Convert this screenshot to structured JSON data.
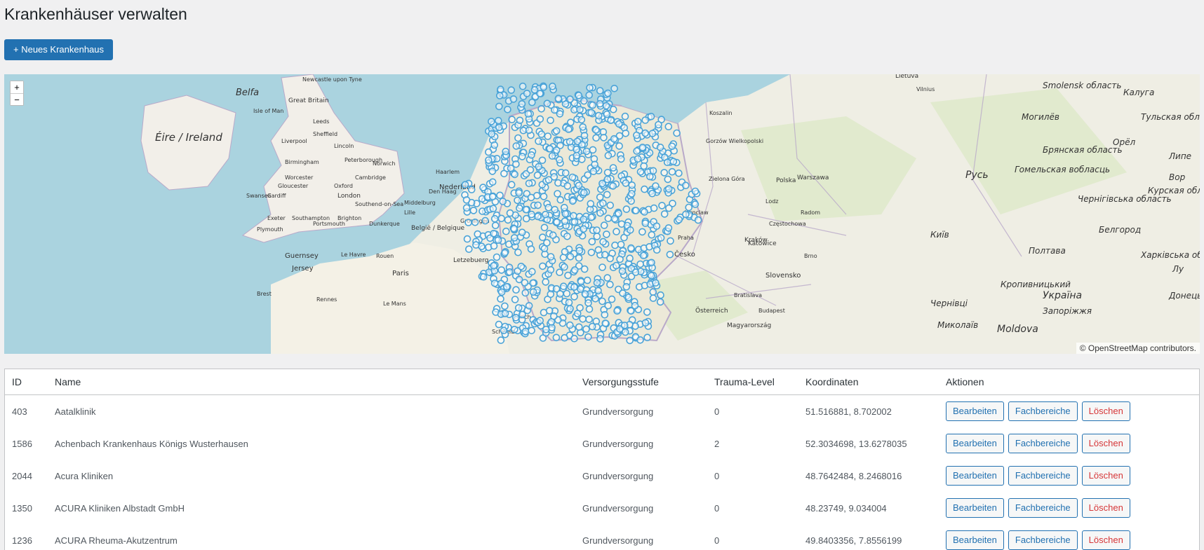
{
  "page": {
    "title": "Krankenhäuser verwalten"
  },
  "actions": {
    "add_label": "+ Neues Krankenhaus"
  },
  "map": {
    "zoom_in": "+",
    "zoom_out": "−",
    "attribution": "© OpenStreetMap contributors.",
    "marker_color": "#4aa3d8",
    "labels": [
      "Belfa",
      "Newcastle upon Tyne",
      "Great Britain",
      "Isle of Man",
      "Éire / Ireland",
      "Leeds",
      "Sheffield",
      "Liverpool",
      "Lincoln",
      "Birmingham",
      "Peterborough",
      "Norwich",
      "Worcester",
      "Cambridge",
      "Gloucester",
      "Oxford",
      "Swansea",
      "Cardiff",
      "London",
      "Southend-on-Sea",
      "Exeter",
      "Southampton",
      "Brighton",
      "Portsmouth",
      "Plymouth",
      "Guernsey",
      "Jersey",
      "Le Havre",
      "Rouen",
      "Paris",
      "Brest",
      "Rennes",
      "Le Mans",
      "Lille",
      "Dunkerque",
      "Groningen",
      "Nederland",
      "Haarlem",
      "Den Haag",
      "Middelburg",
      "België / Belgique",
      "Letzebuerg",
      "Zurich",
      "Schweiz",
      "Lietuva",
      "Vilnius",
      "Koszalin",
      "Gorzów Wielkopolski",
      "Zielona Góra",
      "Polska",
      "Warszawa",
      "Lodz",
      "Radom",
      "Kraków",
      "Wroclaw",
      "Praha",
      "Česko",
      "Slovensko",
      "Bratislava",
      "Österreich",
      "Budapest",
      "Magyarország",
      "Katowice",
      "Częstochowa",
      "Brno",
      "Smolensk область",
      "Калуга",
      "Могилёв",
      "Тульская область",
      "Брянская область",
      "Орёл",
      "Гомельская вобласць",
      "Курская область",
      "Чернігівська область",
      "Київ",
      "Белгород",
      "Полтава",
      "Харківська область",
      "Кропивницький",
      "Україна",
      "Чернівці",
      "Запоріжжя",
      "Донецьк",
      "Миколаїв",
      "Moldova",
      "Pyсь",
      "Липе",
      "Вор",
      "Лу"
    ]
  },
  "table": {
    "headers": {
      "id": "ID",
      "name": "Name",
      "level": "Versorgungsstufe",
      "trauma": "Trauma-Level",
      "coords": "Koordinaten",
      "actions": "Aktionen"
    },
    "button_labels": {
      "edit": "Bearbeiten",
      "departments": "Fachbereiche",
      "delete": "Löschen"
    },
    "rows": [
      {
        "id": "403",
        "name": "Aatalklinik",
        "level": "Grundversorgung",
        "trauma": "0",
        "coords": "51.516881, 8.702002"
      },
      {
        "id": "1586",
        "name": "Achenbach Krankenhaus Königs Wusterhausen",
        "level": "Grundversorgung",
        "trauma": "2",
        "coords": "52.3034698, 13.6278035"
      },
      {
        "id": "2044",
        "name": "Acura Kliniken",
        "level": "Grundversorgung",
        "trauma": "0",
        "coords": "48.7642484, 8.2468016"
      },
      {
        "id": "1350",
        "name": "ACURA Kliniken Albstadt GmbH",
        "level": "Grundversorgung",
        "trauma": "0",
        "coords": "48.23749, 9.034004"
      },
      {
        "id": "1236",
        "name": "ACURA Rheuma-Akutzentrum",
        "level": "Grundversorgung",
        "trauma": "0",
        "coords": "49.8403356, 7.8556199"
      }
    ]
  }
}
